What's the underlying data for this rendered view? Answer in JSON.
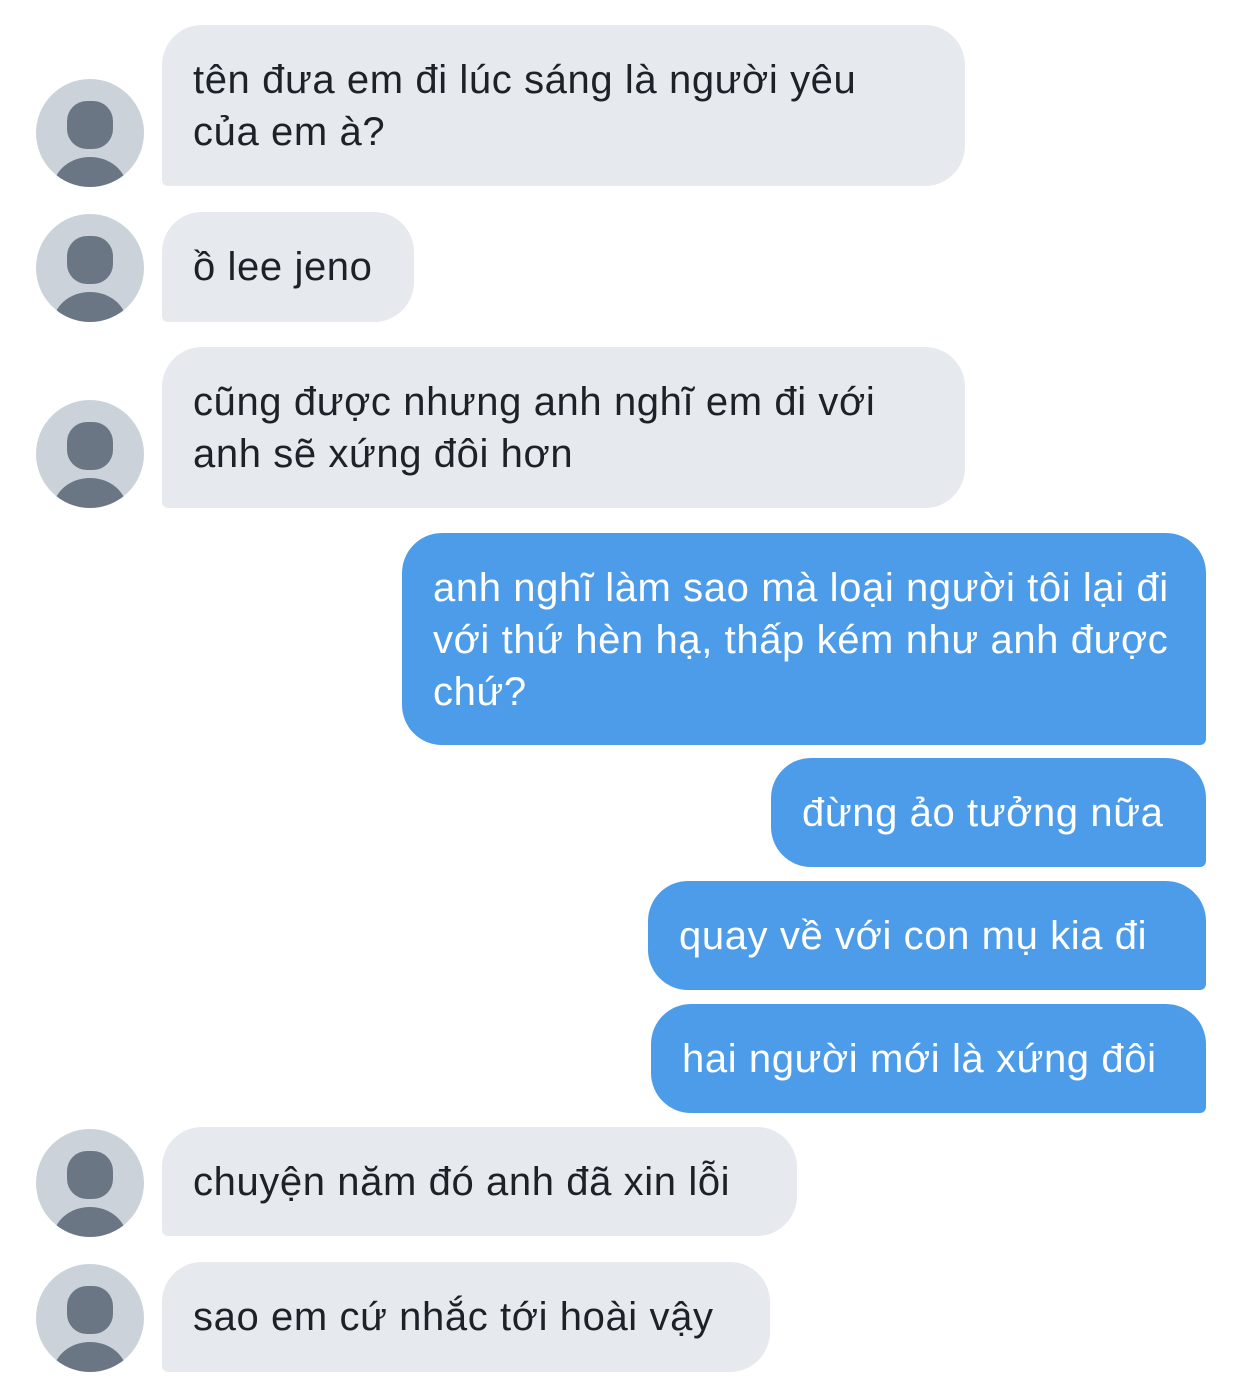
{
  "colors": {
    "incoming_bubble": "#e6e9ee",
    "outgoing_bubble": "#4d9ce9",
    "avatar_bg": "#ccd2d9",
    "avatar_figure": "#6b7685"
  },
  "avatar_icon": "default-person-icon",
  "messages": [
    {
      "direction": "incoming",
      "text": "tên đưa em đi lúc sáng là người yêu của em à?"
    },
    {
      "direction": "incoming",
      "text": "ồ lee jeno"
    },
    {
      "direction": "incoming",
      "text": "cũng được nhưng anh nghĩ em đi với anh sẽ xứng đôi hơn"
    },
    {
      "direction": "outgoing",
      "text": "anh nghĩ làm sao mà loại người tôi lại đi với thứ hèn hạ, thấp kém như anh được chứ?"
    },
    {
      "direction": "outgoing",
      "text": "đừng ảo tưởng nữa"
    },
    {
      "direction": "outgoing",
      "text": "quay về với con mụ kia đi"
    },
    {
      "direction": "outgoing",
      "text": "hai người mới là xứng đôi"
    },
    {
      "direction": "incoming",
      "text": "chuyện năm đó anh đã xin lỗi"
    },
    {
      "direction": "incoming",
      "text": "sao em cứ nhắc tới hoài vậy"
    }
  ]
}
